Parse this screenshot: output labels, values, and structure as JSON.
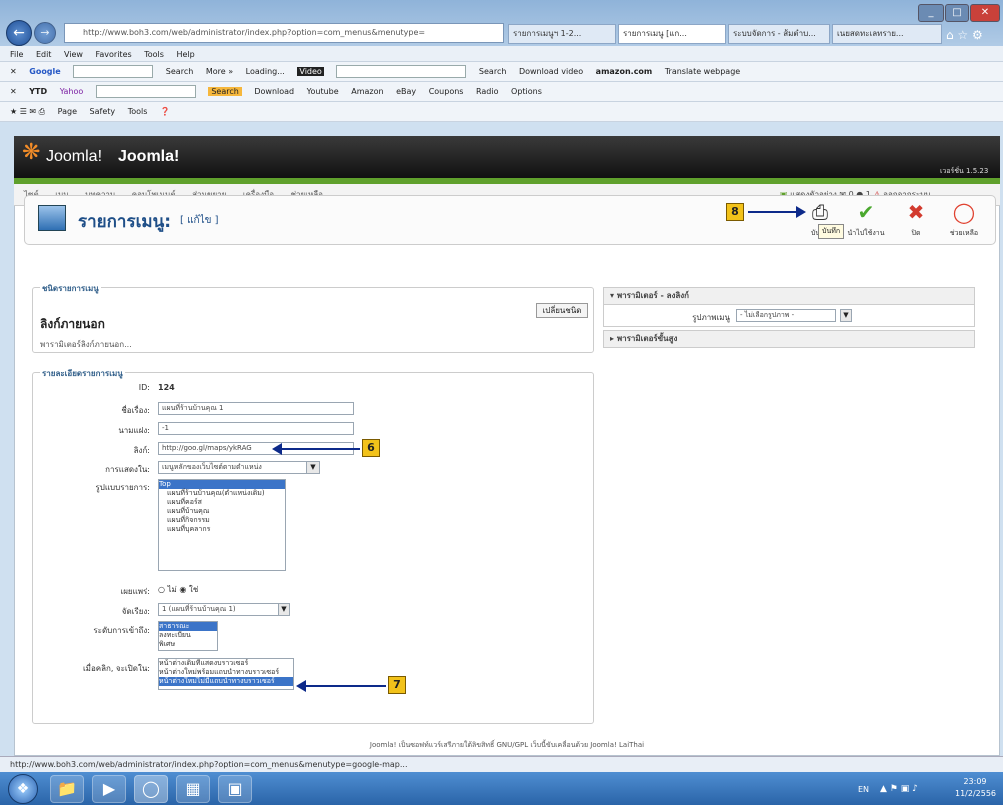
{
  "browser": {
    "address": "http://www.boh3.com/web/administrator/index.php?option=com_menus&menutype=",
    "tabs": [
      "รายการเมนูฯ 1-2...",
      "รายการเมนู [แก...",
      "ระบบจัดการ - ส้มตำบ...",
      "เนยสดทะเลทราย..."
    ],
    "menu_items": [
      "File",
      "Edit",
      "View",
      "Favorites",
      "Tools",
      "Help"
    ],
    "google_label": "Google",
    "google_items": [
      "Search",
      "More »",
      "Loading...",
      "Video"
    ],
    "google_right": [
      "Search",
      "Download video",
      "amazon.com",
      "Translate webpage"
    ],
    "yahoo_bar": [
      "YTD",
      "Yahoo",
      "Search",
      "Download",
      "Youtube",
      "Amazon",
      "eBay",
      "Coupons",
      "Radio",
      "Options"
    ],
    "command_bar": [
      "Page",
      "Safety",
      "Tools"
    ]
  },
  "joomla": {
    "logo": "Joomla!",
    "site_title": "Joomla!",
    "version": "เวอร์ชั่น 1.5.23",
    "menu": [
      "ไซต์",
      "เมนู",
      "บทความ",
      "คอมโพเนนต์",
      "ส่วนขยาย",
      "เครื่องมือ",
      "ช่วยเหลือ"
    ],
    "right_links": [
      "แสดงตัวอย่าง",
      "0",
      "1",
      "ออกจากระบบ"
    ],
    "page_title": "รายการเมนู:",
    "page_subtitle": "[ แก้ไข ]",
    "toolbar": [
      "บันทึก",
      "นำไปใช้งาน",
      "ปิด",
      "ช่วยเหลือ"
    ],
    "tooltip": "บันทึก"
  },
  "form": {
    "type_legend": "ชนิดรายการเมนู",
    "type_name": "ลิงก์ภายนอก",
    "type_desc": "พารามิเตอร์ลิงก์ภายนอก...",
    "change_button": "เปลี่ยนชนิด",
    "details_legend": "รายละเอียดรายการเมนู",
    "id_label": "ID:",
    "id_value": "124",
    "title_label": "ชื่อเรื่อง:",
    "title_value": "แผนที่ร้านบ้านคุณ 1",
    "alias_label": "นามแฝง:",
    "alias_value": "-1",
    "link_label": "ลิงก์:",
    "link_value": "http://goo.gl/maps/ykRAG",
    "display_label": "การแสดงใน:",
    "display_value": "เมนูหลักของเว็บไซต์ตามตำแหน่ง",
    "parent_label": "รูปแบบรายการ:",
    "parent_items": [
      "Top",
      "แผนที่ร้านบ้านคุณ(ตำแหน่งเดิม)",
      "แผนที่คอร์ส",
      "แผนที่บ้านคุณ",
      "แผนที่กิจกรรม",
      "แผนที่บุคลากร"
    ],
    "published_label": "เผยแพร่:",
    "published_no": "ไม่",
    "published_yes": "ใช่",
    "order_label": "จัดเรียง:",
    "order_value": "1 (แผนที่ร้านบ้านคุณ 1)",
    "access_label": "ระดับการเข้าถึง:",
    "access_items": [
      "สาธารณะ",
      "ลงทะเบียน",
      "พิเศษ"
    ],
    "target_label": "เมื่อคลิก, จะเปิดใน:",
    "target_items": [
      "หน้าต่างเดิมที่แสดงบราวเซอร์",
      "หน้าต่างใหม่พร้อมแถบนำทางบราวเซอร์",
      "หน้าต่างใหม่ไม่มีแถบนำทางบราวเซอร์"
    ]
  },
  "params": {
    "basic": "พารามิเตอร์ - ลงลิงก์",
    "menu_image_label": "รูปภาพเมนู",
    "menu_image_value": "- ไม่เลือกรูปภาพ -",
    "advanced": "พารามิเตอร์ขั้นสูง"
  },
  "annotations": {
    "b6": "6",
    "b7": "7",
    "b8": "8"
  },
  "footer": "Joomla! เป็นซอฟท์แวร์เสรีภายใต้ลิขสิทธิ์ GNU/GPL เว็บนี้ขับเคลื่อนด้วย Joomla! LaiThai",
  "status_url": "http://www.boh3.com/web/administrator/index.php?option=com_menus&menutype=google-map...",
  "taskbar": {
    "lang": "EN",
    "time": "23:09",
    "date": "11/2/2556"
  }
}
